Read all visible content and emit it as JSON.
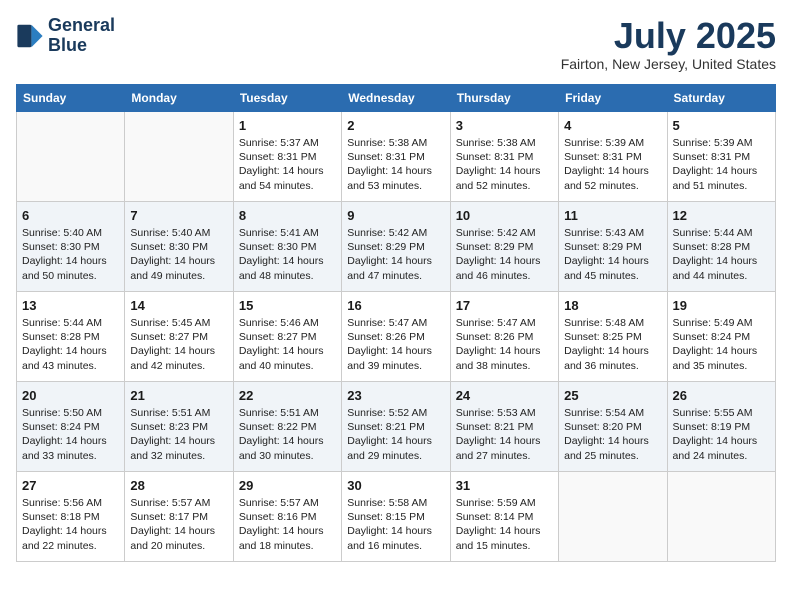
{
  "header": {
    "logo_line1": "General",
    "logo_line2": "Blue",
    "month": "July 2025",
    "location": "Fairton, New Jersey, United States"
  },
  "weekdays": [
    "Sunday",
    "Monday",
    "Tuesday",
    "Wednesday",
    "Thursday",
    "Friday",
    "Saturday"
  ],
  "weeks": [
    [
      {
        "day": "",
        "info": ""
      },
      {
        "day": "",
        "info": ""
      },
      {
        "day": "1",
        "info": "Sunrise: 5:37 AM\nSunset: 8:31 PM\nDaylight: 14 hours and 54 minutes."
      },
      {
        "day": "2",
        "info": "Sunrise: 5:38 AM\nSunset: 8:31 PM\nDaylight: 14 hours and 53 minutes."
      },
      {
        "day": "3",
        "info": "Sunrise: 5:38 AM\nSunset: 8:31 PM\nDaylight: 14 hours and 52 minutes."
      },
      {
        "day": "4",
        "info": "Sunrise: 5:39 AM\nSunset: 8:31 PM\nDaylight: 14 hours and 52 minutes."
      },
      {
        "day": "5",
        "info": "Sunrise: 5:39 AM\nSunset: 8:31 PM\nDaylight: 14 hours and 51 minutes."
      }
    ],
    [
      {
        "day": "6",
        "info": "Sunrise: 5:40 AM\nSunset: 8:30 PM\nDaylight: 14 hours and 50 minutes."
      },
      {
        "day": "7",
        "info": "Sunrise: 5:40 AM\nSunset: 8:30 PM\nDaylight: 14 hours and 49 minutes."
      },
      {
        "day": "8",
        "info": "Sunrise: 5:41 AM\nSunset: 8:30 PM\nDaylight: 14 hours and 48 minutes."
      },
      {
        "day": "9",
        "info": "Sunrise: 5:42 AM\nSunset: 8:29 PM\nDaylight: 14 hours and 47 minutes."
      },
      {
        "day": "10",
        "info": "Sunrise: 5:42 AM\nSunset: 8:29 PM\nDaylight: 14 hours and 46 minutes."
      },
      {
        "day": "11",
        "info": "Sunrise: 5:43 AM\nSunset: 8:29 PM\nDaylight: 14 hours and 45 minutes."
      },
      {
        "day": "12",
        "info": "Sunrise: 5:44 AM\nSunset: 8:28 PM\nDaylight: 14 hours and 44 minutes."
      }
    ],
    [
      {
        "day": "13",
        "info": "Sunrise: 5:44 AM\nSunset: 8:28 PM\nDaylight: 14 hours and 43 minutes."
      },
      {
        "day": "14",
        "info": "Sunrise: 5:45 AM\nSunset: 8:27 PM\nDaylight: 14 hours and 42 minutes."
      },
      {
        "day": "15",
        "info": "Sunrise: 5:46 AM\nSunset: 8:27 PM\nDaylight: 14 hours and 40 minutes."
      },
      {
        "day": "16",
        "info": "Sunrise: 5:47 AM\nSunset: 8:26 PM\nDaylight: 14 hours and 39 minutes."
      },
      {
        "day": "17",
        "info": "Sunrise: 5:47 AM\nSunset: 8:26 PM\nDaylight: 14 hours and 38 minutes."
      },
      {
        "day": "18",
        "info": "Sunrise: 5:48 AM\nSunset: 8:25 PM\nDaylight: 14 hours and 36 minutes."
      },
      {
        "day": "19",
        "info": "Sunrise: 5:49 AM\nSunset: 8:24 PM\nDaylight: 14 hours and 35 minutes."
      }
    ],
    [
      {
        "day": "20",
        "info": "Sunrise: 5:50 AM\nSunset: 8:24 PM\nDaylight: 14 hours and 33 minutes."
      },
      {
        "day": "21",
        "info": "Sunrise: 5:51 AM\nSunset: 8:23 PM\nDaylight: 14 hours and 32 minutes."
      },
      {
        "day": "22",
        "info": "Sunrise: 5:51 AM\nSunset: 8:22 PM\nDaylight: 14 hours and 30 minutes."
      },
      {
        "day": "23",
        "info": "Sunrise: 5:52 AM\nSunset: 8:21 PM\nDaylight: 14 hours and 29 minutes."
      },
      {
        "day": "24",
        "info": "Sunrise: 5:53 AM\nSunset: 8:21 PM\nDaylight: 14 hours and 27 minutes."
      },
      {
        "day": "25",
        "info": "Sunrise: 5:54 AM\nSunset: 8:20 PM\nDaylight: 14 hours and 25 minutes."
      },
      {
        "day": "26",
        "info": "Sunrise: 5:55 AM\nSunset: 8:19 PM\nDaylight: 14 hours and 24 minutes."
      }
    ],
    [
      {
        "day": "27",
        "info": "Sunrise: 5:56 AM\nSunset: 8:18 PM\nDaylight: 14 hours and 22 minutes."
      },
      {
        "day": "28",
        "info": "Sunrise: 5:57 AM\nSunset: 8:17 PM\nDaylight: 14 hours and 20 minutes."
      },
      {
        "day": "29",
        "info": "Sunrise: 5:57 AM\nSunset: 8:16 PM\nDaylight: 14 hours and 18 minutes."
      },
      {
        "day": "30",
        "info": "Sunrise: 5:58 AM\nSunset: 8:15 PM\nDaylight: 14 hours and 16 minutes."
      },
      {
        "day": "31",
        "info": "Sunrise: 5:59 AM\nSunset: 8:14 PM\nDaylight: 14 hours and 15 minutes."
      },
      {
        "day": "",
        "info": ""
      },
      {
        "day": "",
        "info": ""
      }
    ]
  ]
}
